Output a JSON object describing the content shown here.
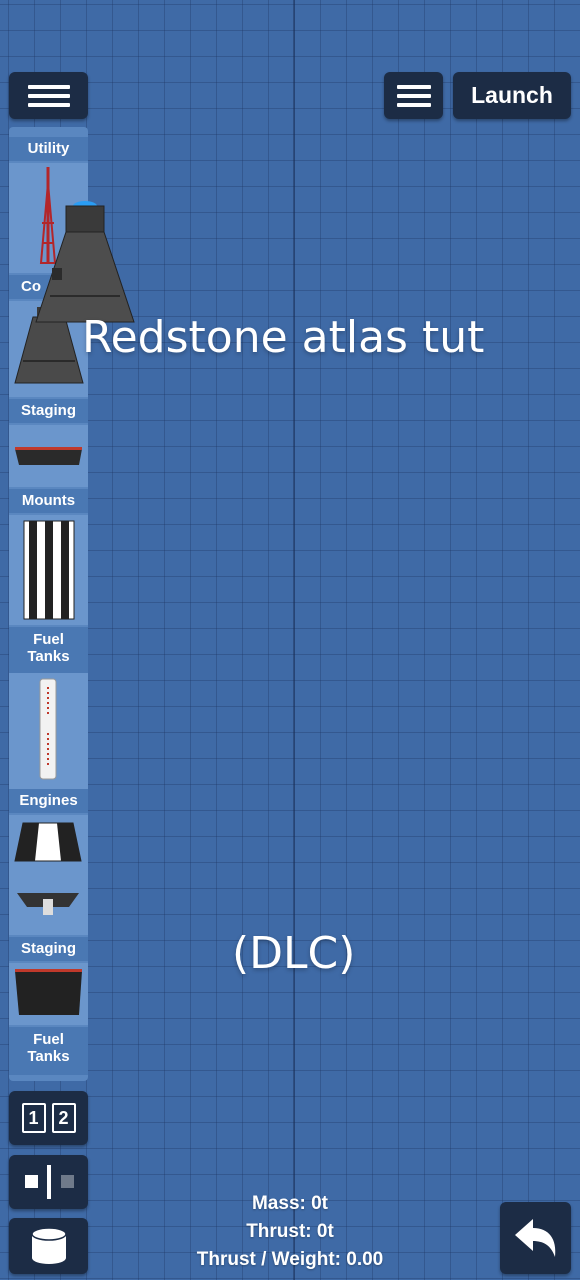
{
  "toolbar": {
    "launch_label": "Launch"
  },
  "sidebar": {
    "categories": [
      {
        "label": "Utility"
      },
      {
        "label": "Co"
      },
      {
        "label": "Staging"
      },
      {
        "label": "Mounts"
      },
      {
        "label": "Fuel\nTanks"
      },
      {
        "label": "Engines"
      },
      {
        "label": "Staging"
      },
      {
        "label": "Fuel\nTanks"
      }
    ]
  },
  "overlay": {
    "title": "Redstone atlas tut",
    "dlc": "(DLC)"
  },
  "stage_buttons": [
    "1",
    "2"
  ],
  "stats": {
    "mass": "Mass: 0t",
    "thrust": "Thrust: 0t",
    "thrust_weight": "Thrust / Weight: 0.00"
  },
  "colors": {
    "background": "#3f6aa6",
    "button": "#1c2c45",
    "sidebar": "#5a87c0"
  }
}
